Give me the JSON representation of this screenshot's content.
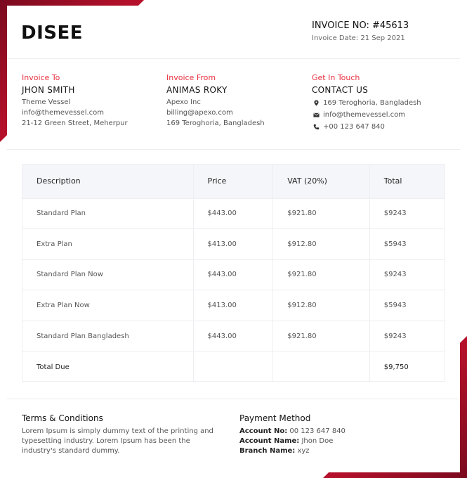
{
  "brand": {
    "logo_text": "DISEE",
    "accent": "#e8303f",
    "corner_color": "#b3102a"
  },
  "invoice": {
    "number": "INVOICE NO: #45613",
    "date": "Invoice Date: 21 Sep 2021"
  },
  "invoice_to": {
    "heading": "Invoice To",
    "name": "JHON SMITH",
    "lines": [
      "Theme Vessel",
      "info@themevessel.com",
      "21-12 Green Street, Meherpur"
    ]
  },
  "invoice_from": {
    "heading": "Invoice From",
    "name": "ANIMAS ROKY",
    "lines": [
      "Apexo Inc",
      "billing@apexo.com",
      "169 Teroghoria, Bangladesh"
    ]
  },
  "contact": {
    "heading": "Get In Touch",
    "name": "CONTACT US",
    "items": [
      {
        "icon": "location-pin-icon",
        "text": "169 Teroghoria, Bangladesh"
      },
      {
        "icon": "envelope-icon",
        "text": "info@themevessel.com"
      },
      {
        "icon": "phone-icon",
        "text": "+00 123 647 840"
      }
    ]
  },
  "table": {
    "headers": [
      "Description",
      "Price",
      "VAT (20%)",
      "Total"
    ],
    "rows": [
      [
        "Standard Plan",
        "$443.00",
        "$921.80",
        "$9243"
      ],
      [
        "Extra Plan",
        "$413.00",
        "$912.80",
        "$5943"
      ],
      [
        "Standard Plan Now",
        "$443.00",
        "$921.80",
        "$9243"
      ],
      [
        "Extra Plan Now",
        "$413.00",
        "$912.80",
        "$5943"
      ],
      [
        "Standard Plan Bangladesh",
        "$443.00",
        "$921.80",
        "$9243"
      ]
    ],
    "total_row": [
      "Total Due",
      "",
      "",
      "$9,750"
    ]
  },
  "terms": {
    "title": "Terms & Conditions",
    "body": "Lorem Ipsum is simply dummy text of the printing and typesetting industry. Lorem Ipsum has been the industry's standard dummy."
  },
  "payment": {
    "title": "Payment Method",
    "lines": [
      {
        "label": "Account No:",
        "value": "00 123 647 840"
      },
      {
        "label": "Account Name:",
        "value": "Jhon Doe"
      },
      {
        "label": "Branch Name:",
        "value": "xyz"
      }
    ]
  }
}
